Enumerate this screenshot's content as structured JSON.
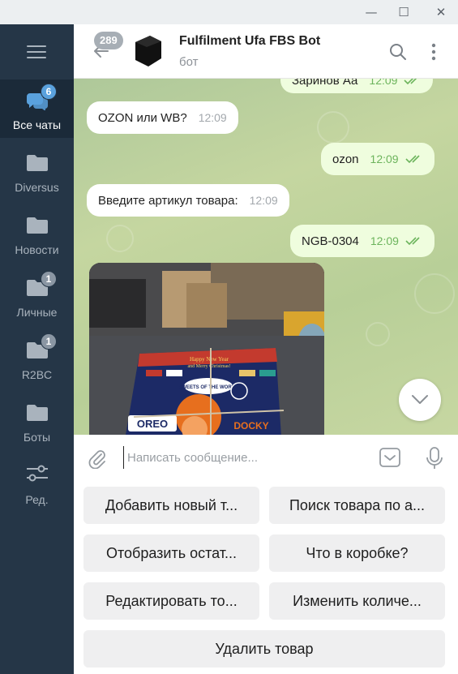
{
  "window": {
    "controls": {
      "minimize": "—",
      "maximize": "☐",
      "close": "✕"
    }
  },
  "sidebar": {
    "folders": [
      {
        "label": "Все чаты",
        "badge": "6",
        "icon": "chats-icon"
      },
      {
        "label": "Diversus",
        "badge": "",
        "icon": "folder-icon"
      },
      {
        "label": "Новости",
        "badge": "",
        "icon": "folder-icon"
      },
      {
        "label": "Личные",
        "badge": "1",
        "icon": "folder-icon"
      },
      {
        "label": "R2BC",
        "badge": "1",
        "icon": "folder-icon"
      },
      {
        "label": "Боты",
        "badge": "",
        "icon": "folder-icon"
      },
      {
        "label": "Ред.",
        "badge": "",
        "icon": "sliders-icon"
      }
    ]
  },
  "header": {
    "unread_count": "289",
    "title": "Fulfilment Ufa FBS Bot",
    "status": "бот"
  },
  "messages": [
    {
      "direction": "out",
      "text": "Заринов Аа",
      "time": "12:09",
      "read": true
    },
    {
      "direction": "in",
      "text": "OZON или WB?",
      "time": "12:09"
    },
    {
      "direction": "out",
      "text": "ozon",
      "time": "12:09",
      "read": true
    },
    {
      "direction": "in",
      "text": "Введите артикул товара:",
      "time": "12:09"
    },
    {
      "direction": "out",
      "text": "NGB-0304",
      "time": "12:09",
      "read": true
    }
  ],
  "photo": {
    "box_text_1": "Happy New Year",
    "box_text_2": "and Merry Christmas!",
    "box_text_3": "SWEETS OF THE WORLD",
    "box_text_4": "OREO",
    "box_text_5": "DOCKY"
  },
  "composer": {
    "placeholder": "Написать сообщение..."
  },
  "keyboard": {
    "buttons": [
      "Добавить новый т...",
      "Поиск товара по а...",
      "Отобразить остат...",
      "Что в коробке?",
      "Редактировать то...",
      "Изменить количе...",
      "Удалить товар"
    ]
  },
  "colors": {
    "sidebar_bg": "#253647",
    "sidebar_active": "#1b2a39",
    "badge": "#5aa1dd",
    "outgoing_bubble": "#effdde",
    "read_check": "#6cb45c",
    "chat_bg": "#b8cf98"
  }
}
